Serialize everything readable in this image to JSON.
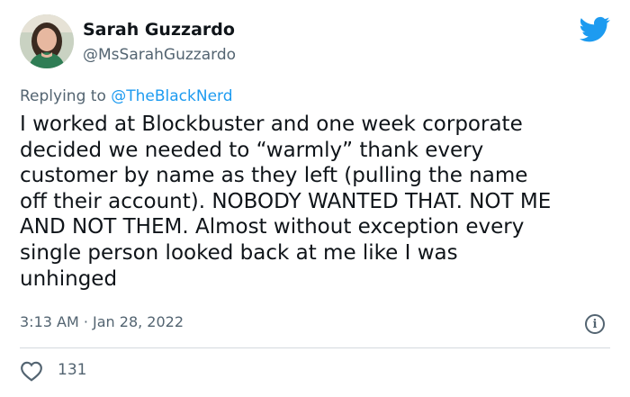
{
  "author": {
    "name": "Sarah Guzzardo",
    "handle": "@MsSarahGuzzardo"
  },
  "reply": {
    "prefix": "Replying to ",
    "target": "@TheBlackNerd"
  },
  "tweet_text": "I worked at Blockbuster and one week corporate\ndecided we needed to “warmly” thank every\ncustomer by name as they left (pulling the name\noff their account). NOBODY WANTED THAT. NOT ME\nAND NOT THEM. Almost without exception every\nsingle person looked back at me like I was\nunhinged",
  "meta": {
    "timestamp": "3:13 AM · Jan 28, 2022"
  },
  "stats": {
    "likes": "131"
  },
  "colors": {
    "brand": "#1d9bf0",
    "text": "#0f1419",
    "secondary": "#536471",
    "divider": "#d4dade"
  },
  "icons": {
    "brand": "twitter-bird-icon",
    "info": "info-icon",
    "like": "heart-icon"
  }
}
